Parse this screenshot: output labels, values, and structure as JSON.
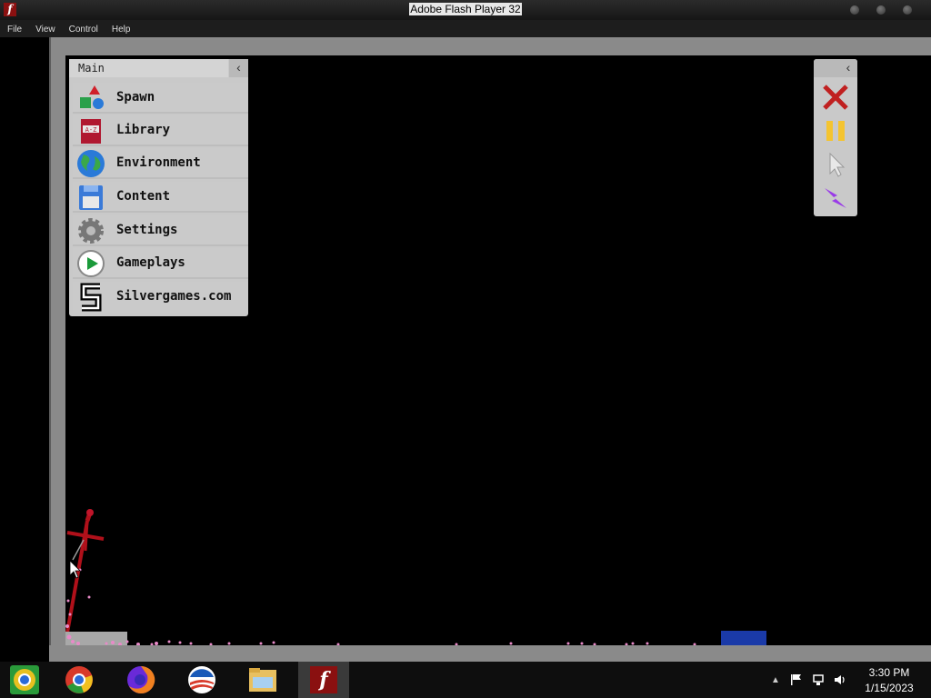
{
  "window": {
    "title": "Adobe Flash Player 32"
  },
  "menubar": {
    "items": [
      "File",
      "View",
      "Control",
      "Help"
    ]
  },
  "main_panel": {
    "title": "Main",
    "items": [
      {
        "label": "Spawn",
        "icon": "spawn-shapes-icon"
      },
      {
        "label": "Library",
        "icon": "library-book-icon"
      },
      {
        "label": "Environment",
        "icon": "globe-icon"
      },
      {
        "label": "Content",
        "icon": "floppy-disk-icon"
      },
      {
        "label": "Settings",
        "icon": "gear-icon"
      },
      {
        "label": "Gameplays",
        "icon": "play-icon"
      },
      {
        "label": "Silvergames.com",
        "icon": "silvergames-logo-icon"
      }
    ]
  },
  "tool_panel": {
    "tools": [
      "close-x-icon",
      "pause-icon",
      "pointer-icon",
      "lightning-icon"
    ]
  },
  "taskbar": {
    "apps": [
      "chromium-icon",
      "chrome-icon",
      "firefox-icon",
      "obama-logo-icon",
      "file-explorer-icon",
      "flash-player-icon"
    ],
    "time": "3:30 PM",
    "date": "1/15/2023"
  },
  "colors": {
    "panel_bg": "#c9c9c9",
    "stage_bg": "#000000",
    "frame": "#8a8a8a",
    "ragdoll_red": "#b0101a",
    "particle_pink": "#e88ac8",
    "block_blue": "#1a3aa8"
  }
}
